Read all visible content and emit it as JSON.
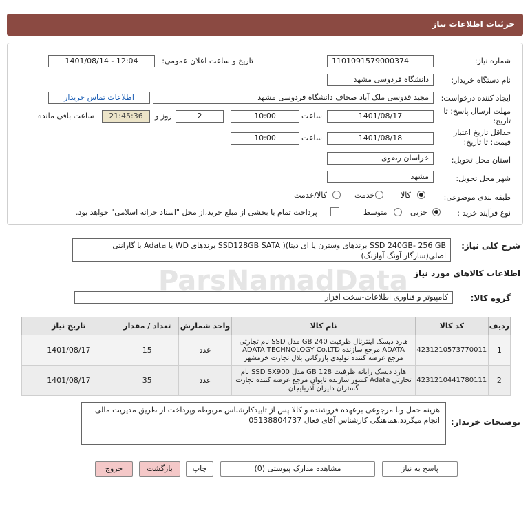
{
  "page": {
    "title": "جزئیات اطلاعات نیاز"
  },
  "form": {
    "need_number_label": "شماره نیاز:",
    "need_number": "1101091579000374",
    "announce_label": "تاریخ و ساعت اعلان عمومی:",
    "announce_value": "1401/08/14 - 12:04",
    "buyer_label": "نام دستگاه خریدار:",
    "buyer_value": "دانشگاه فردوسی مشهد",
    "creator_label": "ایجاد کننده درخواست:",
    "creator_value": "مجید قدوسی ملک آباد صحاف دانشگاه فردوسی مشهد",
    "contact_link": "اطلاعات تماس خریدار",
    "deadline_label": "مهلت ارسال پاسخ: تا تاریخ:",
    "deadline_date": "1401/08/17",
    "time_label": "ساعت",
    "deadline_time": "10:00",
    "days_value": "2",
    "days_label": "روز و",
    "remaining_time": "21:45:36",
    "remaining_label": "ساعت باقی مانده",
    "validity_label": "حداقل تاریخ اعتبار قیمت: تا تاریخ:",
    "validity_date": "1401/08/18",
    "validity_time": "10:00",
    "province_label": "استان محل تحویل:",
    "province_value": "خراسان رضوی",
    "city_label": "شهر محل تحویل:",
    "city_value": "مشهد",
    "category_label": "طبقه بندی موضوعی:",
    "category_options": [
      "کالا",
      "خدمت",
      "کالا/خدمت"
    ],
    "category_selected": "کالا",
    "process_label": "نوع فرآیند خرید :",
    "process_options": [
      "جزیی",
      "متوسط"
    ],
    "process_selected": "جزیی",
    "payment_note": "پرداخت تمام یا بخشی از مبلغ خرید،از محل \"اسناد خزانه اسلامی\" خواهد بود."
  },
  "summary": {
    "label": "شرح کلی نیاز:",
    "text": "SSD 240GB- 256 GB برندهای وسترن یا ای دیتا)(  SSD128GB SATA برندهای WD یا Adata با گارانتی اصلی(سازگار آونگ آوازنگ)"
  },
  "goods": {
    "section_title": "اطلاعات کالاهای مورد نیاز",
    "group_label": "گروه کالا:",
    "group_value": "کامپیوتر و فناوری اطلاعات-سخت افزار",
    "columns": [
      "ردیف",
      "کد کالا",
      "نام کالا",
      "واحد شمارش",
      "تعداد / مقدار",
      "تاریخ نیاز"
    ],
    "rows": [
      {
        "index": "1",
        "code": "4231210573770011",
        "name": "هارد دیسک اینترنال ظرفیت 240 GB مدل SSD نام تجارتی ADATA مرجع سازنده ADATA TECHNOLOGY Co.LTD مرجع عرضه کننده تولیدی بازرگانی بلال تجارت خرمشهر",
        "unit": "عدد",
        "qty": "15",
        "date": "1401/08/17"
      },
      {
        "index": "2",
        "code": "4231210441780111",
        "name": "هارد دیسک رایانه ظرفیت 128 GB مدل SSD SX900 نام تجارتی Adata کشور سازنده تایوان مرجع عرضه کننده تجارت گستران دلیران آذربایجان",
        "unit": "عدد",
        "qty": "35",
        "date": "1401/08/17"
      }
    ]
  },
  "notes": {
    "label": "توضیحات خریدار:",
    "text": "هزینه حمل  وبا مرجوعی برعهده فروشنده و کالا پس از تاییدکارشناس مربوطه وپرداخت از طریق مدیریت مالی انجام میگردد.هماهنگی کارشناس آقای فعال 05138804737"
  },
  "buttons": {
    "reply": "پاسخ به نیاز",
    "attachments": "مشاهده مدارک پیوستی (0)",
    "print": "چاپ",
    "back": "بازگشت",
    "exit": "خروج"
  },
  "watermark": {
    "text": "ParsNamadData"
  }
}
